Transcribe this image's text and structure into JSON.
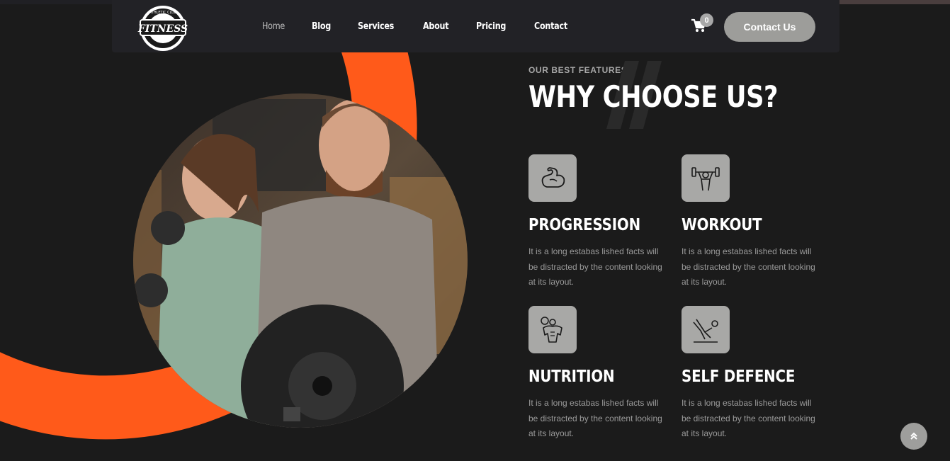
{
  "brand": {
    "logo_text": "FITNESS",
    "logo_ring_text": "ATHLETIC CLUB"
  },
  "nav": {
    "items": [
      {
        "label": "Home",
        "active": true
      },
      {
        "label": "Blog",
        "active": false
      },
      {
        "label": "Services",
        "active": false
      },
      {
        "label": "About",
        "active": false
      },
      {
        "label": "Pricing",
        "active": false
      },
      {
        "label": "Contact",
        "active": false
      }
    ],
    "cart_icon": "cart-icon",
    "cart_count": "0",
    "cta_label": "Contact Us"
  },
  "section": {
    "eyebrow": "OUR BEST FEATURES",
    "title": "WHY CHOOSE US?"
  },
  "features": [
    {
      "title": "PROGRESSION",
      "text": "It is a long estabas lished facts will be distracted by the content looking at its layout.",
      "icon": "flexed-arm-icon"
    },
    {
      "title": "WORKOUT",
      "text": "It is a long estabas lished facts will be distracted by the content looking at its layout.",
      "icon": "dumbbell-lift-icon"
    },
    {
      "title": "NUTRITION",
      "text": "It is a long estabas lished facts will be distracted by the content looking at its layout.",
      "icon": "bodybuilder-icon"
    },
    {
      "title": "SELF DEFENCE",
      "text": "It is a long estabas lished facts will be distracted by the content looking at its layout.",
      "icon": "situp-icon"
    }
  ],
  "colors": {
    "accent": "#ff5a1a",
    "background": "#1b1b1b",
    "nav_bg": "#222226",
    "icon_box": "#a8a8a6"
  },
  "scroll_top_icon": "double-chevron-up-icon"
}
